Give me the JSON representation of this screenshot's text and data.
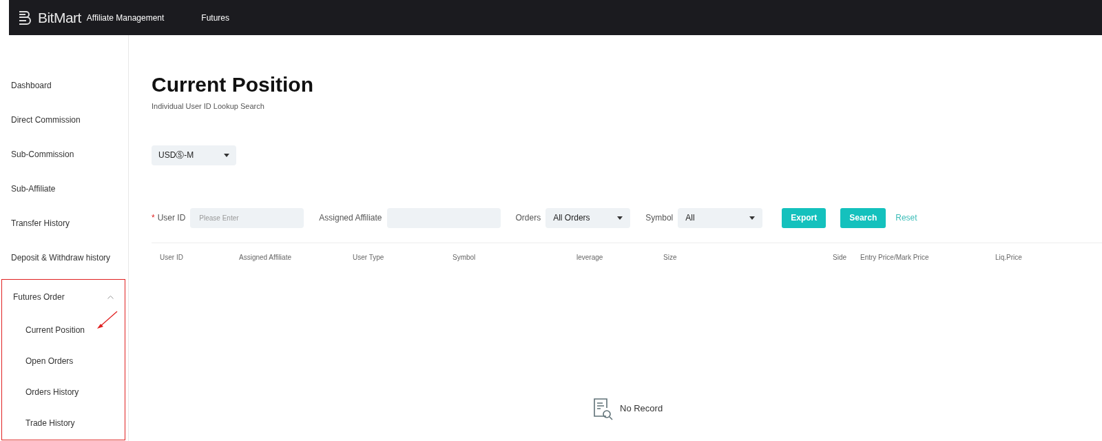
{
  "header": {
    "brand": "BitMart",
    "product": "Affiliate Management",
    "nav": [
      {
        "label": "Futures"
      }
    ]
  },
  "sidebar": {
    "items": [
      {
        "label": "Dashboard"
      },
      {
        "label": "Direct Commission"
      },
      {
        "label": "Sub-Commission"
      },
      {
        "label": "Sub-Affiliate"
      },
      {
        "label": "Transfer History"
      },
      {
        "label": "Deposit & Withdraw history"
      },
      {
        "label": "Futures Order",
        "expanded": true,
        "highlighted": true,
        "children": [
          {
            "label": "Current Position",
            "arrow": true
          },
          {
            "label": "Open Orders"
          },
          {
            "label": "Orders History"
          },
          {
            "label": "Trade History"
          }
        ]
      }
    ]
  },
  "page": {
    "title": "Current Position",
    "subtitle": "Individual User ID Lookup Search",
    "market_select": {
      "value": "USDⓈ-M"
    },
    "filters": [
      {
        "kind": "input",
        "label": "User ID",
        "required_mark": "*",
        "placeholder": "Please Enter"
      },
      {
        "kind": "input",
        "label": "Assigned Affiliate"
      },
      {
        "kind": "select",
        "label": "Orders",
        "value": "All Orders"
      },
      {
        "kind": "select",
        "label": "Symbol",
        "value": "All"
      }
    ],
    "buttons": [
      {
        "kind": "primary",
        "label": "Export"
      },
      {
        "kind": "primary",
        "label": "Search"
      },
      {
        "kind": "link",
        "label": "Reset"
      }
    ],
    "table": {
      "columns": [
        "User ID",
        "Assigned Affiliate",
        "User Type",
        "Symbol",
        "leverage",
        "Size",
        "Side",
        "Entry Price/Mark Price",
        "Liq.Price"
      ],
      "empty_text": "No Record"
    }
  }
}
